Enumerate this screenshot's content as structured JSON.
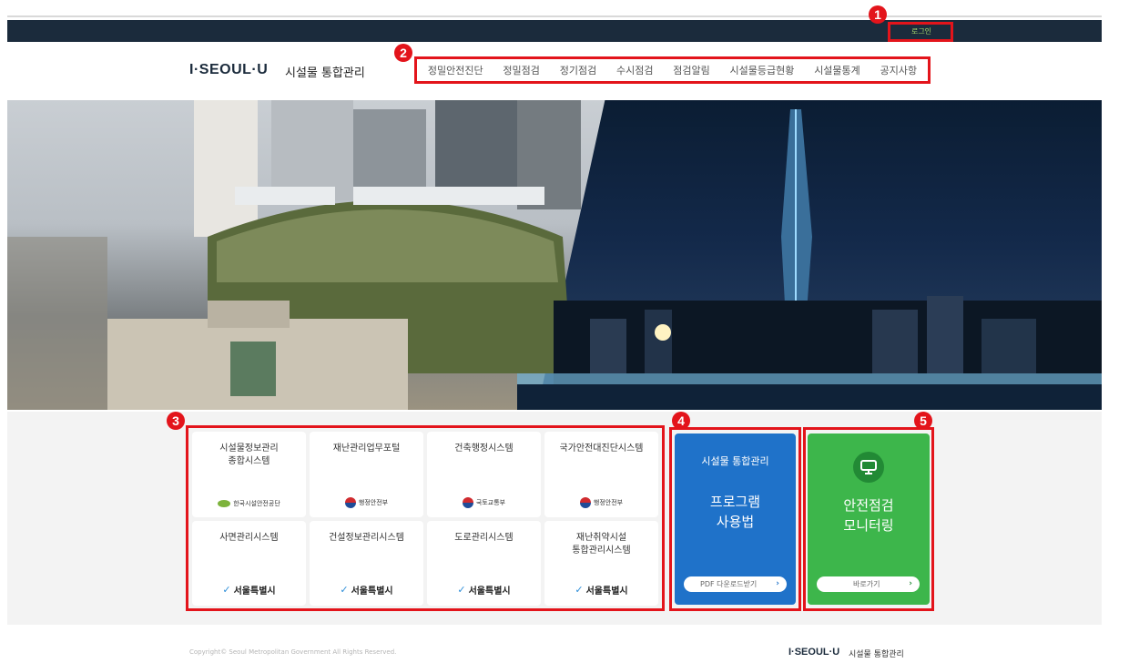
{
  "topbar": {
    "login_label": "로그인"
  },
  "header": {
    "logo": "I·SEOUL·U",
    "logo_sub": "시설물 통합관리",
    "nav": [
      "정밀안전진단",
      "정밀점검",
      "정기점검",
      "수시점검",
      "점검알림",
      "시설물등급현황",
      "시설물통계",
      "공지사항"
    ]
  },
  "systems": [
    {
      "title": "시설물정보관리\n종합시스템",
      "org": "한국시설안전공단",
      "org_type": "kalis"
    },
    {
      "title": "재난관리업무포털",
      "org": "행정안전부",
      "org_type": "gov"
    },
    {
      "title": "건축행정시스템",
      "org": "국토교통부",
      "org_type": "gov"
    },
    {
      "title": "국가안전대진단시스템",
      "org": "행정안전부",
      "org_type": "gov"
    },
    {
      "title": "사면관리시스템",
      "org": "서울특별시",
      "org_type": "seoul"
    },
    {
      "title": "건설정보관리시스템",
      "org": "서울특별시",
      "org_type": "seoul"
    },
    {
      "title": "도로관리시스템",
      "org": "서울특별시",
      "org_type": "seoul"
    },
    {
      "title": "재난취약시설\n통합관리시스템",
      "org": "서울특별시",
      "org_type": "seoul"
    }
  ],
  "program_panel": {
    "subtitle": "시설물 통합관리",
    "title": "프로그램\n사용법",
    "button": "PDF 다운로드받기",
    "color": "#1f72c9"
  },
  "monitor_panel": {
    "title": "안전점검\n모니터링",
    "button": "바로가기",
    "icon": "monitor-icon",
    "color": "#3db64b"
  },
  "badges": [
    "1",
    "2",
    "3",
    "4",
    "5"
  ],
  "footer": {
    "copyright": "Copyright© Seoul Metropolitan Government All Rights Reserved.",
    "logo": "I·SEOUL·U",
    "logo_sub": "시설물 통합관리"
  }
}
